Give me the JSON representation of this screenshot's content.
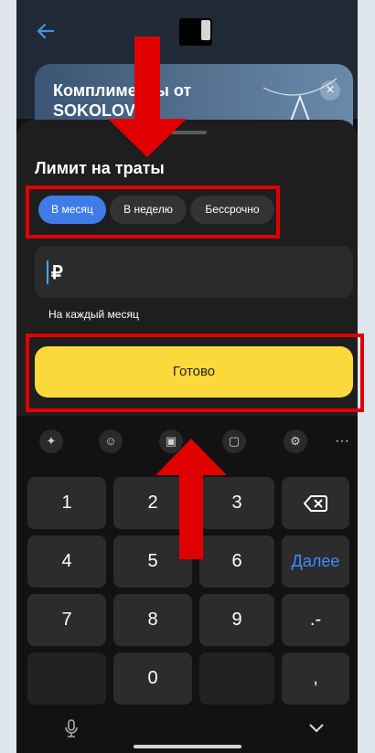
{
  "background_app": {
    "promo_title": "Комплименты от SOKOLOV",
    "promo_close": "×"
  },
  "sheet": {
    "title": "Лимит на траты",
    "tabs": [
      {
        "label": "В месяц",
        "active": true
      },
      {
        "label": "В неделю",
        "active": false
      },
      {
        "label": "Бессрочно",
        "active": false
      }
    ],
    "amount": {
      "currency": "₽",
      "value": ""
    },
    "hint": "На каждый месяц",
    "done_label": "Готово"
  },
  "keyboard": {
    "toolbar_icons": [
      "sparkle-icon",
      "emoji-icon",
      "sticker-icon",
      "clipboard-icon",
      "settings-icon",
      "more-icon"
    ],
    "more_label": "···",
    "keys": {
      "k1": "1",
      "k2": "2",
      "k3": "3",
      "k4": "4",
      "k5": "5",
      "k6": "6",
      "k7": "7",
      "k8": "8",
      "k9": "9",
      "k0": "0",
      "next": "Далее",
      "dot_minus": ".-",
      "comma": ","
    }
  },
  "colors": {
    "accent_blue": "#3f7ce8",
    "done_yellow": "#fcd93a",
    "annotation_red": "#e10000"
  }
}
